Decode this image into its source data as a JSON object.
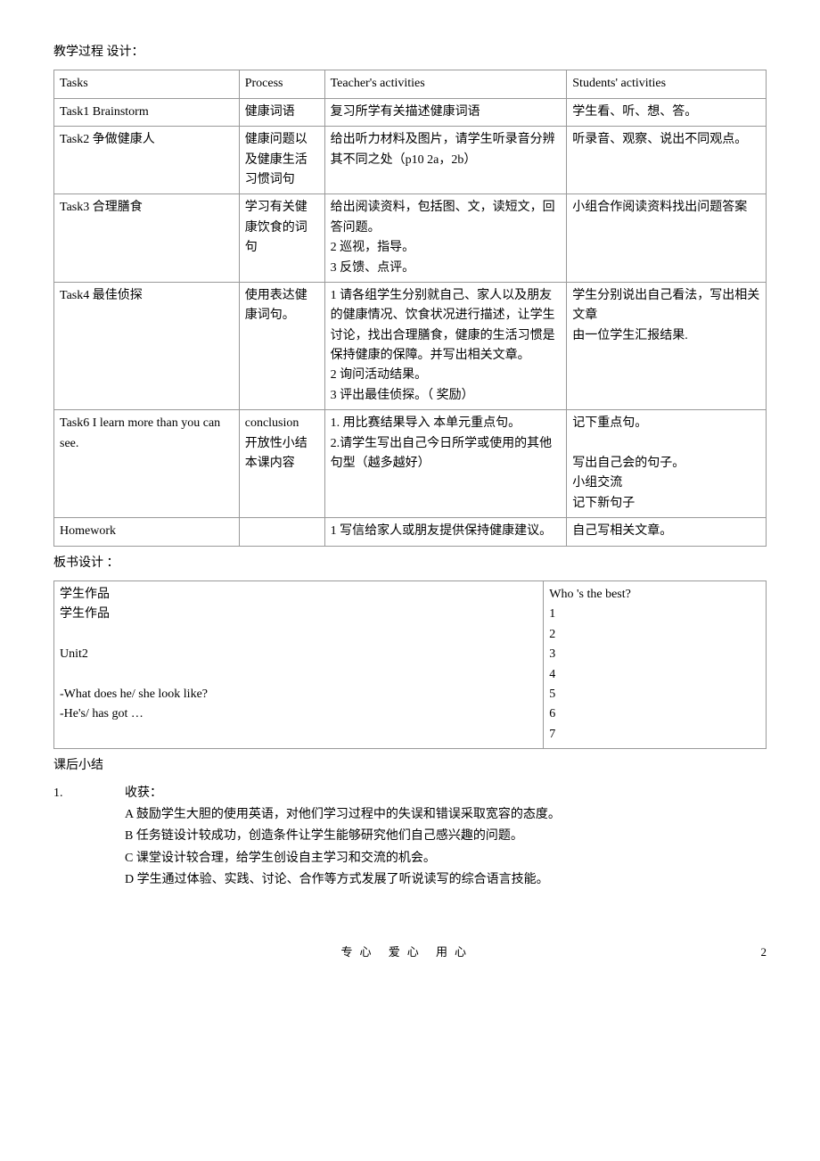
{
  "title": "教学过程  设计：",
  "main_table": {
    "header": [
      "Tasks",
      "Process",
      "Teacher's activities",
      "Students'  activities"
    ],
    "rows": [
      {
        "c1": "Task1            Brainstorm",
        "c2": "健康词语",
        "c3": "复习所学有关描述健康词语",
        "c4": "学生看、听、想、答。"
      },
      {
        "c1": "Task2 争做健康人",
        "c2": "健康问题以及健康生活习惯词句",
        "c3": "给出听力材料及图片，请学生听录音分辨其不同之处（p10 2a，2b）",
        "c4": "听录音、观察、说出不同观点。"
      },
      {
        "c1": "Task3 合理膳食",
        "c2": "学习有关健康饮食的词句",
        "c3": "给出阅读资料，包括图、文，读短文，回答问题。\n2 巡视，指导。\n3 反馈、点评。",
        "c4": "小组合作阅读资料找出问题答案"
      },
      {
        "c1": "  Task4 最佳侦探",
        "c2": "使用表达健康词句。",
        "c3": "1 请各组学生分别就自己、家人以及朋友的健康情况、饮食状况进行描述，让学生讨论，找出合理膳食，健康的生活习惯是保持健康的保障。并写出相关文章。\n2 询问活动结果。\n3 评出最佳侦探。（ 奖励）",
        "c4": "学生分别说出自己看法，写出相关文章\n由一位学生汇报结果."
      },
      {
        "c1": "Task6 I learn more than you can see.",
        "c2": "conclusion\n开放性小结本课内容",
        "c3": "1. 用比赛结果导入    本单元重点句。\n2.请学生写出自己今日所学或使用的其他句型（越多越好）",
        "c4": "记下重点句。\n\n写出自己会的句子。\n小组交流\n记下新句子"
      },
      {
        "c1": "Homework",
        "c2": "",
        "c3": "  1 写信给家人或朋友提供保持健康建议。",
        "c4": "自己写相关文章。"
      }
    ]
  },
  "board_title": "板书设计  ：",
  "board_table": {
    "left": "学生作品\n学生作品\n\n              Unit2\n\n-What does he/ she look like?\n-He's/ has got …",
    "right": "Who 's the best?\n1\n2\n3\n4\n5\n6\n7"
  },
  "summary_title": "课后小结",
  "summary": {
    "num": "1.",
    "label": "收获：",
    "items": [
      "A 鼓励学生大胆的使用英语，对他们学习过程中的失误和错误采取宽容的态度。",
      "B 任务链设计较成功，创造条件让学生能够研究他们自己感兴趣的问题。",
      "C 课堂设计较合理，给学生创设自主学习和交流的机会。",
      "D 学生通过体验、实践、讨论、合作等方式发展了听说读写的综合语言技能。"
    ]
  },
  "footer": {
    "center": "专心  爱心  用心",
    "page": "2"
  }
}
